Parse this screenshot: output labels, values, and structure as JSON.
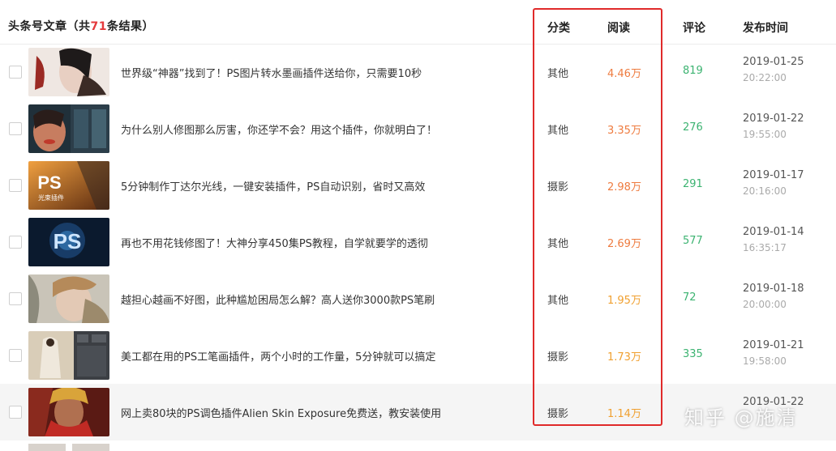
{
  "header": {
    "title_prefix": "头条号文章（共",
    "count": "71",
    "title_suffix": "条结果）",
    "col_category": "分类",
    "col_reads": "阅读",
    "col_comments": "评论",
    "col_publish": "发布时间"
  },
  "colors": {
    "reads_hot": "#ee7b3f",
    "reads_warm": "#f0a030",
    "comments": "#3cb371",
    "highlight_box": "#e02a2a"
  },
  "rows": [
    {
      "title": "世界级“神器”找到了！PS图片转水墨画插件送给你，只需要10秒",
      "category": "其他",
      "reads": "4.46万",
      "comments": "819",
      "date": "2019-01-25",
      "time": "20:22:00"
    },
    {
      "title": "为什么别人修图那么厉害，你还学不会？用这个插件，你就明白了！",
      "category": "其他",
      "reads": "3.35万",
      "comments": "276",
      "date": "2019-01-22",
      "time": "19:55:00"
    },
    {
      "title": "5分钟制作丁达尔光线，一键安装插件，PS自动识别，省时又高效",
      "category": "摄影",
      "reads": "2.98万",
      "comments": "291",
      "date": "2019-01-17",
      "time": "20:16:00",
      "thumb_text": "PS",
      "thumb_sub": "光束插件"
    },
    {
      "title": "再也不用花钱修图了！大神分享450集PS教程，自学就要学的透彻",
      "category": "其他",
      "reads": "2.69万",
      "comments": "577",
      "date": "2019-01-14",
      "time": "16:35:17",
      "thumb_text": "PS"
    },
    {
      "title": "越担心越画不好图，此种尴尬困局怎么解？高人送你3000款PS笔刷",
      "category": "其他",
      "reads": "1.95万",
      "comments": "72",
      "date": "2019-01-18",
      "time": "20:00:00"
    },
    {
      "title": "美工都在用的PS工笔画插件，两个小时的工作量，5分钟就可以搞定",
      "category": "摄影",
      "reads": "1.73万",
      "comments": "335",
      "date": "2019-01-21",
      "time": "19:58:00"
    },
    {
      "title": "网上卖80块的PS调色插件Alien Skin Exposure免费送，教安装使用",
      "category": "摄影",
      "reads": "1.14万",
      "comments": "",
      "date": "2019-01-22",
      "time": ""
    }
  ],
  "watermark": "知乎 @施清"
}
